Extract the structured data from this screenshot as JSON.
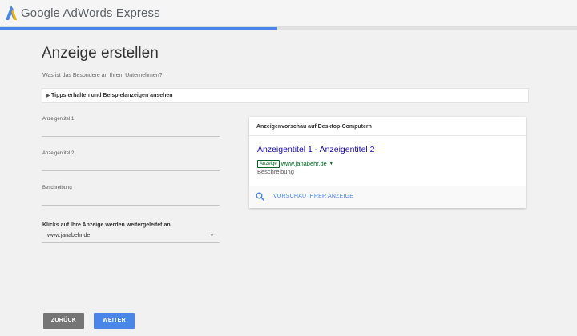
{
  "app": {
    "brand": "Google AdWords Express",
    "logo_icon": "adwords-logo-icon",
    "colors": {
      "logo_blue": "#4a86e8",
      "logo_yellow": "#f4b400",
      "accent": "#4a86e8",
      "ad_green": "#006621",
      "ad_title": "#1a0dab"
    },
    "progress_fraction": 0.48
  },
  "page": {
    "title": "Anzeige erstellen",
    "subtitle": "Was ist das Besondere an Ihrem Unternehmen?"
  },
  "tips": {
    "caret_icon": "triangle-right-icon",
    "label": "Tipps erhalten und Beispielanzeigen ansehen"
  },
  "form": {
    "headline1_label": "Anzeigentitel 1",
    "headline2_label": "Anzeigentitel 2",
    "description_label": "Beschreibung",
    "redirect_label": "Klicks auf Ihre Anzeige werden weitergeleitet an",
    "redirect_value": "www.janabehr.de"
  },
  "preview": {
    "header": "Anzeigenvorschau auf Desktop-Computern",
    "ad_title": "Anzeigentitel 1 - Anzeigentitel 2",
    "ad_badge": "Anzeige",
    "ad_url": "www.janabehr.de",
    "ad_description": "Beschreibung",
    "link_icon": "search-icon",
    "link_label": "VORSCHAU IHRER ANZEIGE"
  },
  "buttons": {
    "back": "ZURÜCK",
    "next": "WEITER"
  }
}
